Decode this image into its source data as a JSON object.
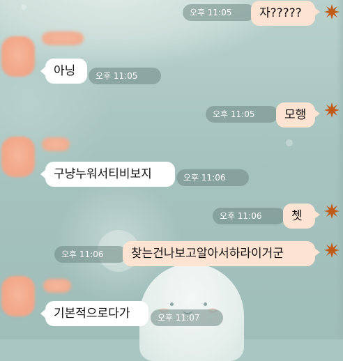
{
  "chat": {
    "messages": [
      {
        "direction": "out",
        "text": "자?????",
        "time": "오후 11:05"
      },
      {
        "direction": "in",
        "text": "아닝",
        "time": "오후 11:05"
      },
      {
        "direction": "out",
        "text": "모행",
        "time": "오후 11:05"
      },
      {
        "direction": "in",
        "text": "구냥누워서티비보지",
        "time": "오후 11:06"
      },
      {
        "direction": "out",
        "text": "쳇",
        "time": "오후 11:06"
      },
      {
        "direction": "out",
        "text": "찾는건나보고알아서하라이거군",
        "time": "오후 11:06"
      },
      {
        "direction": "in",
        "text": "기본적으로다가",
        "time": "오후 11:07"
      }
    ]
  },
  "colors": {
    "incoming_bubble": "#ffffff",
    "outgoing_bubble": "#fde3d2",
    "timestamp_pill": "#708884",
    "read_icon": "#c05b1a"
  },
  "icons": {
    "read_marker": "sunburst-icon"
  }
}
